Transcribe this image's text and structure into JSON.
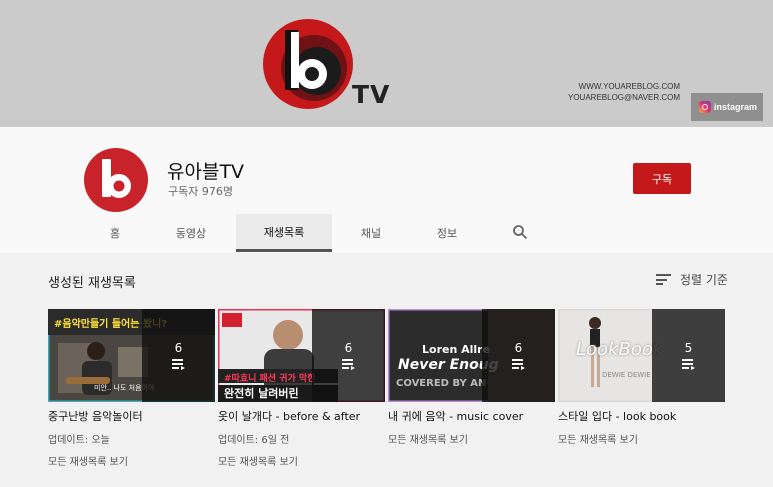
{
  "banner": {
    "brand_suffix": "TV",
    "website": "WWW.YOUAREBLOG.COM",
    "email": "YOUAREBLOG@NAVER.COM",
    "instagram_label": "instagram"
  },
  "channel": {
    "name": "유아블TV",
    "subscribers": "구독자 976명",
    "subscribe_label": "구독"
  },
  "tabs": [
    "홈",
    "동영상",
    "재생목록",
    "채널",
    "정보"
  ],
  "active_tab": "재생목록",
  "section": {
    "title": "생성된 재생목록",
    "sort_label": "정렬 기준"
  },
  "playlists": [
    {
      "title": "중구난방 음악놀이터",
      "count": "6",
      "updated": "업데이트: 오늘",
      "link": "모든 재생목록 보기",
      "thumb_caption_top": "#음악만들기 들어는 봤니?",
      "thumb_caption_bottom": "미안.. 나도 처음이야"
    },
    {
      "title": "옷이 날개다 - before & after",
      "count": "6",
      "updated": "업데이트: 6일 전",
      "link": "모든 재생목록 보기",
      "thumb_caption_top": "#따효니 패션 귀가 막힌",
      "thumb_caption_bottom": "완전히 날려버린"
    },
    {
      "title": "내 귀에 음악 - music cover",
      "count": "6",
      "updated": "",
      "link": "모든 재생목록 보기",
      "thumb_caption_top": "Loren Allre",
      "thumb_caption_mid": "Never Enoug",
      "thumb_caption_bottom": "COVERED BY AN"
    },
    {
      "title": "스타일 입다 - look book",
      "count": "5",
      "updated": "",
      "link": "모든 재생목록 보기",
      "thumb_caption_top": "LookBook",
      "thumb_caption_bottom": "DEWIE DEWIE"
    }
  ],
  "colors": {
    "brand_red": "#c4181b",
    "banner_bg": "#cbcbcb",
    "header_bg": "#f9f9f9",
    "content_bg": "#f1f1f1"
  },
  "icons": [
    "brand-logo-icon",
    "instagram-icon",
    "search-icon",
    "sort-icon",
    "playlist-icon"
  ]
}
